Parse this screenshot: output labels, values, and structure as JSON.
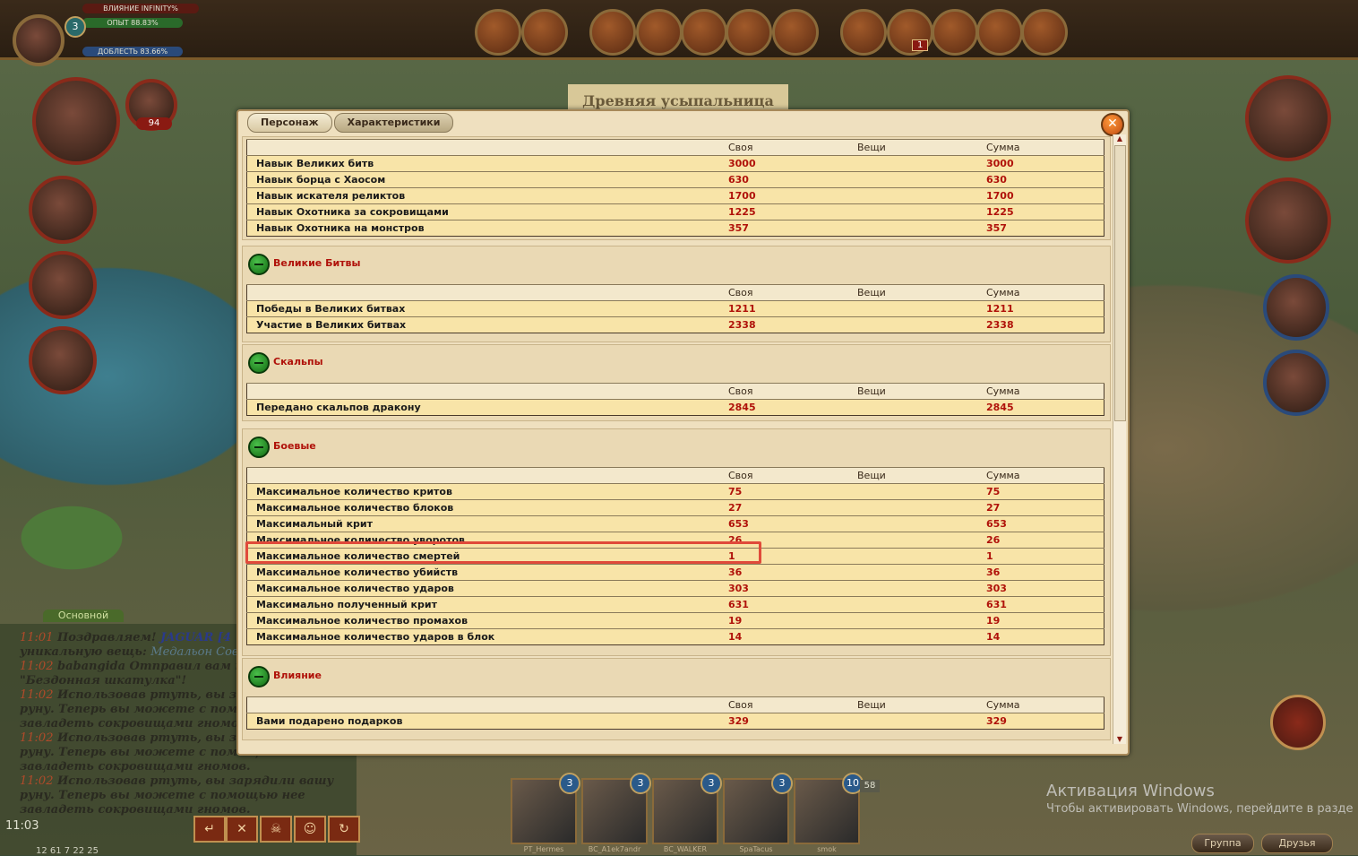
{
  "player": {
    "level": "3",
    "influence": "ВЛИЯНИЕ INFINITY%",
    "exp": "ОПЫТ 88.83%",
    "valor": "ДОБЛЕСТЬ 83.66%",
    "counter": "94",
    "notif_count": "1"
  },
  "location": "Древняя усыпальница",
  "dialog": {
    "tabs": [
      "Персонаж",
      "Характеристики"
    ],
    "close": "✕",
    "columns": {
      "own": "Своя",
      "items": "Вещи",
      "sum": "Сумма"
    },
    "top_rows": [
      {
        "name": "Навык Великих битв",
        "own": "3000",
        "sum": "3000"
      },
      {
        "name": "Навык борца с Хаосом",
        "own": "630",
        "sum": "630"
      },
      {
        "name": "Навык искателя реликтов",
        "own": "1700",
        "sum": "1700"
      },
      {
        "name": "Навык Охотника за сокровищами",
        "own": "1225",
        "sum": "1225"
      },
      {
        "name": "Навык Охотника на монстров",
        "own": "357",
        "sum": "357"
      }
    ],
    "sections": [
      {
        "title": "Великие Битвы",
        "rows": [
          {
            "name": "Победы в Великих битвах",
            "own": "1211",
            "sum": "1211"
          },
          {
            "name": "Участие в Великих битвах",
            "own": "2338",
            "sum": "2338"
          }
        ]
      },
      {
        "title": "Скальпы",
        "rows": [
          {
            "name": "Передано скальпов дракону",
            "own": "2845",
            "sum": "2845"
          }
        ]
      },
      {
        "title": "Боевые",
        "rows": [
          {
            "name": "Максимальное количество критов",
            "own": "75",
            "sum": "75"
          },
          {
            "name": "Максимальное количество блоков",
            "own": "27",
            "sum": "27"
          },
          {
            "name": "Максимальный крит",
            "own": "653",
            "sum": "653"
          },
          {
            "name": "Максимальное количество уворотов",
            "own": "26",
            "sum": "26"
          },
          {
            "name": "Максимальное количество смертей",
            "own": "1",
            "sum": "1"
          },
          {
            "name": "Максимальное количество убийств",
            "own": "36",
            "sum": "36"
          },
          {
            "name": "Максимальное количество ударов",
            "own": "303",
            "sum": "303"
          },
          {
            "name": "Максимально полученный крит",
            "own": "631",
            "sum": "631"
          },
          {
            "name": "Максимальное количество промахов",
            "own": "19",
            "sum": "19"
          },
          {
            "name": "Максимальное количество ударов в блок",
            "own": "14",
            "sum": "14"
          }
        ]
      },
      {
        "title": "Влияние",
        "rows": [
          {
            "name": "Вами подарено подарков",
            "own": "329",
            "sum": "329"
          }
        ]
      }
    ]
  },
  "chat": {
    "tab": "Основной",
    "lines": [
      {
        "time": "11:01",
        "text": "Поздравляем!",
        "extra": "JAGUAR [4"
      },
      {
        "time": "",
        "text": "уникальную вещь:",
        "extra": "Медальон Совенка"
      },
      {
        "time": "11:02",
        "text": "babangida Отправил вам под",
        "extra": ""
      },
      {
        "time": "",
        "text": "\"Бездонная шкатулка\"!",
        "extra": ""
      },
      {
        "time": "11:02",
        "text": "Использовав ртуть, вы заряд",
        "extra": ""
      },
      {
        "time": "",
        "text": "руну. Теперь вы можете с помощь",
        "extra": ""
      },
      {
        "time": "",
        "text": "завладеть сокровищами гномов.",
        "extra": ""
      },
      {
        "time": "11:02",
        "text": "Использовав ртуть, вы заряд",
        "extra": ""
      },
      {
        "time": "",
        "text": "руну. Теперь вы можете с помощью нее",
        "extra": ""
      },
      {
        "time": "",
        "text": "завладеть сокровищами гномов.",
        "extra": ""
      },
      {
        "time": "11:02",
        "text": "Использовав ртуть, вы зарядили вашу",
        "extra": ""
      },
      {
        "time": "",
        "text": "руну. Теперь вы можете с помощью нее",
        "extra": ""
      },
      {
        "time": "",
        "text": "завладеть сокровищами гномов.",
        "extra": ""
      }
    ],
    "clock": "11:03",
    "stats": "12 61 7 22 25"
  },
  "cards": [
    {
      "n": "3",
      "name": "PT_Hermes"
    },
    {
      "n": "3",
      "name": "BC_A1ek7andr"
    },
    {
      "n": "3",
      "name": "BC_WALKER"
    },
    {
      "n": "3",
      "name": "SpaTacus"
    },
    {
      "n": "10",
      "name": "smok"
    }
  ],
  "cards_extra": "58",
  "windows": {
    "title": "Активация Windows",
    "subtitle": "Чтобы активировать Windows, перейдите в разде"
  },
  "buttons": {
    "group": "Группа",
    "friends": "Друзья"
  },
  "colors": {
    "value_red": "#b0120a",
    "row_yellow": "#f8e4a8",
    "panel": "#efe0bf",
    "highlight": "#e04a3a"
  }
}
